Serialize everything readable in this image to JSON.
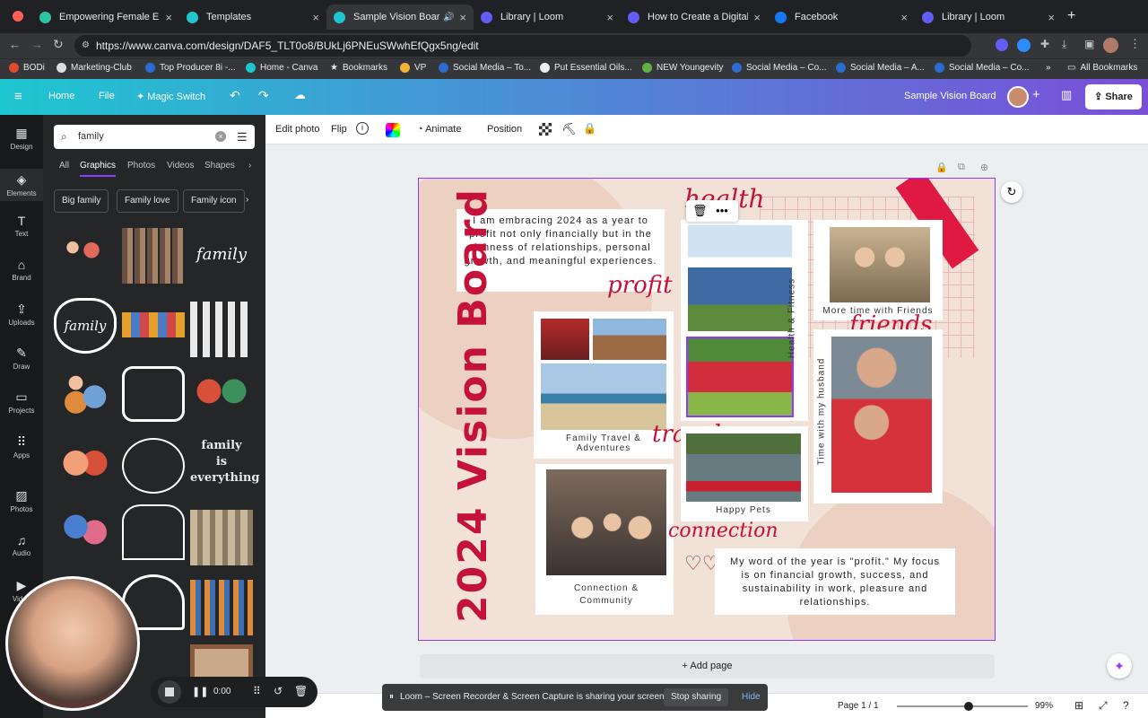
{
  "tabs": [
    {
      "title": "Empowering Female Entre",
      "color": "#2ec4a3"
    },
    {
      "title": "Templates",
      "color": "#1ec6d0"
    },
    {
      "title": "Sample Vision Board",
      "color": "#1ec6d0"
    },
    {
      "title": "Library | Loom",
      "color": "#625df5"
    },
    {
      "title": "How to Create a Digital V",
      "color": "#625df5"
    },
    {
      "title": "Facebook",
      "color": "#1877f2"
    },
    {
      "title": "Library | Loom",
      "color": "#625df5"
    }
  ],
  "url": "https://www.canva.com/design/DAF5_TLT0o8/BUkLj6PNEuSWwhEfQgx5ng/edit",
  "bookmarks": [
    "BODi",
    "Marketing-Club",
    "Top Producer 8i -...",
    "Home - Canva",
    "Bookmarks",
    "VP",
    "Social Media – To...",
    "Put Essential Oils...",
    "NEW Youngevity",
    "Social Media – Co...",
    "Social Media – A...",
    "Social Media – Co..."
  ],
  "all_bookmarks": "All Bookmarks",
  "header": {
    "home": "Home",
    "file": "File",
    "magic": "Magic Switch",
    "title": "Sample Vision Board",
    "share": "Share"
  },
  "rail": [
    "Design",
    "Elements",
    "Text",
    "Brand",
    "Uploads",
    "Draw",
    "Projects",
    "Apps",
    "Photos",
    "Audio",
    "Video"
  ],
  "search": {
    "value": "family"
  },
  "panel_tabs": [
    "All",
    "Graphics",
    "Photos",
    "Videos",
    "Shapes"
  ],
  "chips": [
    "Big family",
    "Family love",
    "Family icon"
  ],
  "toolbar": {
    "edit": "Edit photo",
    "flip": "Flip",
    "animate": "Animate",
    "position": "Position"
  },
  "board": {
    "quote": "I am embracing 2024 as a year to profit not only financially but in the richness of relationships, personal growth, and meaningful experiences.",
    "word": "My word of the year is \"profit.\" My focus is on financial growth, success, and sustainability in work, pleasure and relationships.",
    "big_title": "2024 Vision Board",
    "scripts": {
      "health": "health",
      "profit": "profit",
      "friends": "friends",
      "travel": "travel",
      "connection": "connection"
    },
    "labels": {
      "family_travel": "Family Travel & Adventures",
      "health_fitness": "Health & Fitness",
      "friends_time": "More time with Friends",
      "husband": "Time with my husband",
      "pets": "Happy Pets",
      "community": "Connection & Community"
    }
  },
  "add_page": "+ Add page",
  "loom": {
    "msg": "Loom – Screen Recorder & Screen Capture is sharing your screen.",
    "stop": "Stop sharing",
    "hide": "Hide"
  },
  "recorder": {
    "time": "0:00"
  },
  "page_indicator": "Page 1 / 1",
  "zoom": "99%"
}
